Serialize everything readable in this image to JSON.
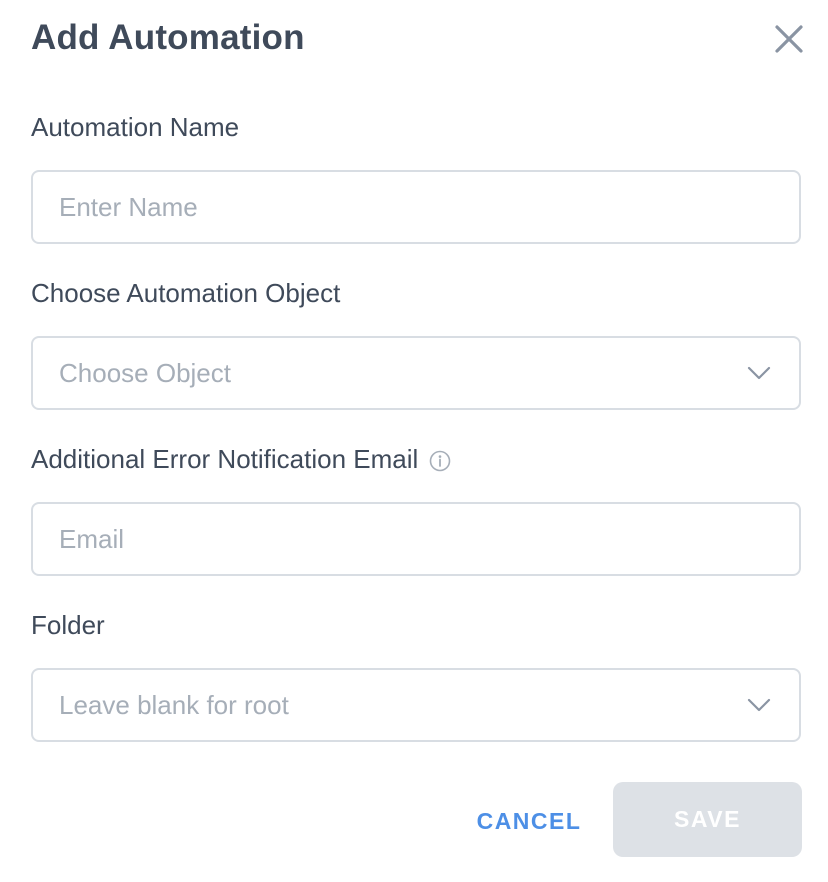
{
  "dialog": {
    "title": "Add Automation",
    "close_icon": "close-icon"
  },
  "fields": {
    "name": {
      "label": "Automation Name",
      "placeholder": "Enter Name",
      "value": ""
    },
    "object": {
      "label": "Choose Automation Object",
      "placeholder": "Choose Object",
      "icon": "chevron-down-icon"
    },
    "email": {
      "label": "Additional Error Notification Email",
      "info_icon": "info-icon",
      "placeholder": "Email",
      "value": ""
    },
    "folder": {
      "label": "Folder",
      "placeholder": "Leave blank for root",
      "icon": "chevron-down-icon"
    }
  },
  "actions": {
    "cancel_label": "CANCEL",
    "save_label": "SAVE",
    "save_enabled": false
  },
  "colors": {
    "text": "#3f4a5a",
    "placeholder": "#a6aeb8",
    "border": "#d8dde3",
    "accent": "#4d8fe6",
    "disabled_button": "#dde1e6"
  }
}
